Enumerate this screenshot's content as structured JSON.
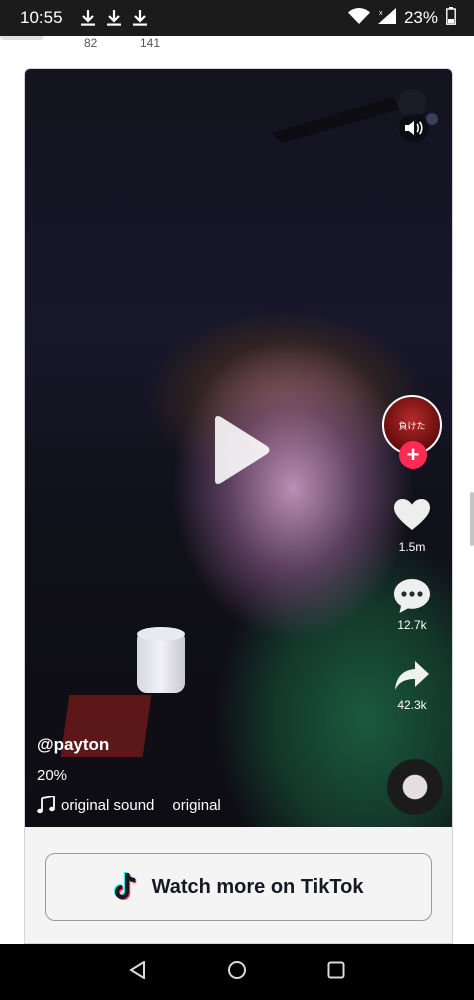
{
  "status_bar": {
    "time": "10:55",
    "battery": "23%",
    "icons": [
      "download-icon",
      "download-icon",
      "download-icon",
      "wifi-icon",
      "signal-icon",
      "battery-icon"
    ]
  },
  "previous_counts": [
    "82",
    "141"
  ],
  "video": {
    "username": "@payton",
    "caption": "20%",
    "sound_name": "original sound",
    "sound_author": "original",
    "avatar_text": "負けた",
    "likes": "1.5m",
    "comments": "12.7k",
    "shares": "42.3k"
  },
  "watch_more_label": "Watch more on TikTok",
  "colors": {
    "follow_accent": "#fe2c55",
    "tiktok_cyan": "#25f4ee",
    "tiktok_red": "#fe2c55",
    "status_bar_bg": "#1b1b1b"
  }
}
